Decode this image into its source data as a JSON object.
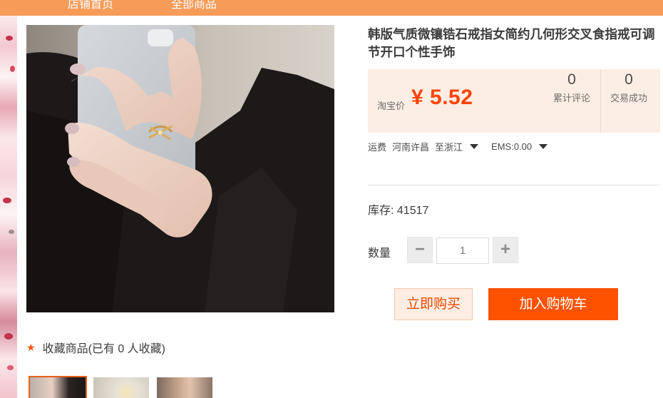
{
  "nav": {
    "items": [
      "店铺首页",
      "全部商品"
    ]
  },
  "product": {
    "title": "韩版气质微镶锆石戒指女简约几何形交叉食指戒可调节开口个性手饰",
    "price_label": "淘宝价",
    "price": "¥ 5.52",
    "reviews_count": "0",
    "reviews_label": "累计评论",
    "sales_count": "0",
    "sales_label": "交易成功",
    "shipping_label": "运费",
    "ship_from": "河南许昌",
    "ship_to": "至浙江",
    "ems": "EMS:0.00",
    "stock_text": "库存:  41517",
    "quantity_label": "数量",
    "quantity_value": "1",
    "buy_now_label": "立即购买",
    "add_cart_label": "加入购物车",
    "favorite_text": "收藏商品(已有 0 人收藏)"
  },
  "colors": {
    "nav_bar": "#f79b58",
    "price": "#ff4400",
    "price_box": "#fdeee5",
    "add_cart": "#ff5200",
    "buy_now_bg": "#feede3"
  },
  "icons": [
    "star-icon",
    "dropdown-caret-icon",
    "minus-icon",
    "plus-icon"
  ]
}
